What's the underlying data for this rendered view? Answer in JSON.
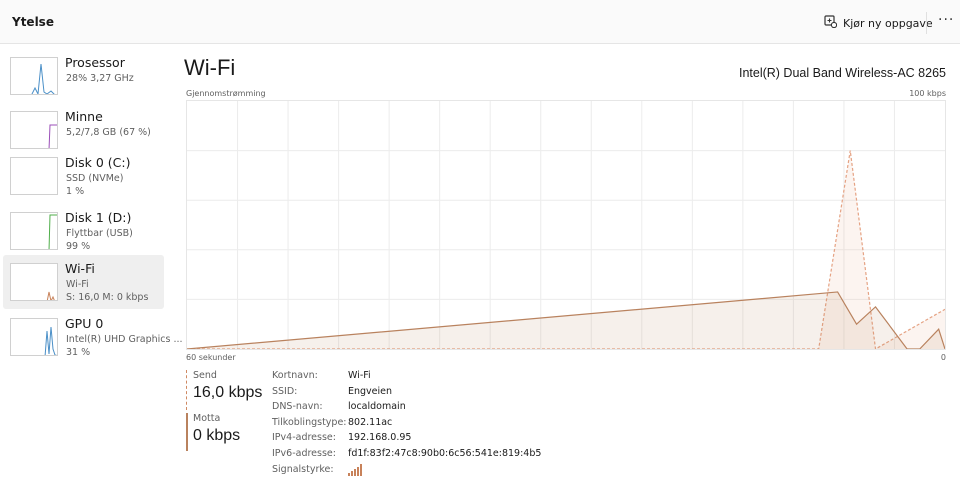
{
  "header": {
    "title": "Ytelse",
    "run_task_label": "Kjør ny oppgave",
    "more_label": "···"
  },
  "sidebar": {
    "items": [
      {
        "name": "Prosessor",
        "sub1": "28% 3,27 GHz",
        "sub2": "",
        "color": "#4a8fc7"
      },
      {
        "name": "Minne",
        "sub1": "5,2/7,8 GB (67 %)",
        "sub2": "",
        "color": "#9b4fb8"
      },
      {
        "name": "Disk 0 (C:)",
        "sub1": "SSD (NVMe)",
        "sub2": "1 %",
        "color": "#4fae4a"
      },
      {
        "name": "Disk 1 (D:)",
        "sub1": "Flyttbar (USB)",
        "sub2": "99 %",
        "color": "#4fae4a"
      },
      {
        "name": "Wi-Fi",
        "sub1": "Wi-Fi",
        "sub2": "S: 16,0 M: 0 kbps",
        "color": "#c8825a"
      },
      {
        "name": "GPU 0",
        "sub1": "Intel(R) UHD Graphics ...",
        "sub2": "31 %",
        "color": "#4a8fc7"
      }
    ]
  },
  "main": {
    "title": "Wi-Fi",
    "adapter": "Intel(R) Dual Band Wireless-AC 8265",
    "chart_ylabel": "Gjennomstrømming",
    "chart_ymax": "100 kbps",
    "chart_xlabel": "60 sekunder",
    "chart_xmin": "0"
  },
  "stats": {
    "send_label": "Send",
    "send_value": "16,0 kbps",
    "recv_label": "Motta",
    "recv_value": "0 kbps"
  },
  "properties": [
    {
      "key": "Kortnavn:",
      "value": "Wi-Fi"
    },
    {
      "key": "SSID:",
      "value": "Engveien"
    },
    {
      "key": "DNS-navn:",
      "value": "localdomain"
    },
    {
      "key": "Tilkoblingstype:",
      "value": "802.11ac"
    },
    {
      "key": "IPv4-adresse:",
      "value": "192.168.0.95"
    },
    {
      "key": "IPv6-adresse:",
      "value": "fd1f:83f2:47c8:90b0:6c56:541e:819:4b5"
    },
    {
      "key": "Signalstyrke:",
      "value": ""
    }
  ],
  "chart_data": {
    "type": "area",
    "title": "",
    "ylabel": "Gjennomstrømming",
    "xlabel": "60 sekunder",
    "xlim": [
      60,
      0
    ],
    "ylim": [
      0,
      100
    ],
    "unit": "kbps",
    "grid": true,
    "series": [
      {
        "name": "",
        "color": "#e5a283",
        "style": "dashed",
        "x": [
          60,
          10,
          7.5,
          5.5,
          0
        ],
        "y": [
          0,
          0,
          80,
          0,
          16
        ]
      },
      {
        "name": "",
        "color": "#b9825e",
        "style": "solid",
        "x": [
          60,
          8.5,
          7,
          5.5,
          3,
          2,
          0.5,
          0
        ],
        "y": [
          0,
          23,
          10,
          17,
          0,
          0,
          8,
          0
        ]
      }
    ]
  },
  "signal_color": "#c8825a"
}
